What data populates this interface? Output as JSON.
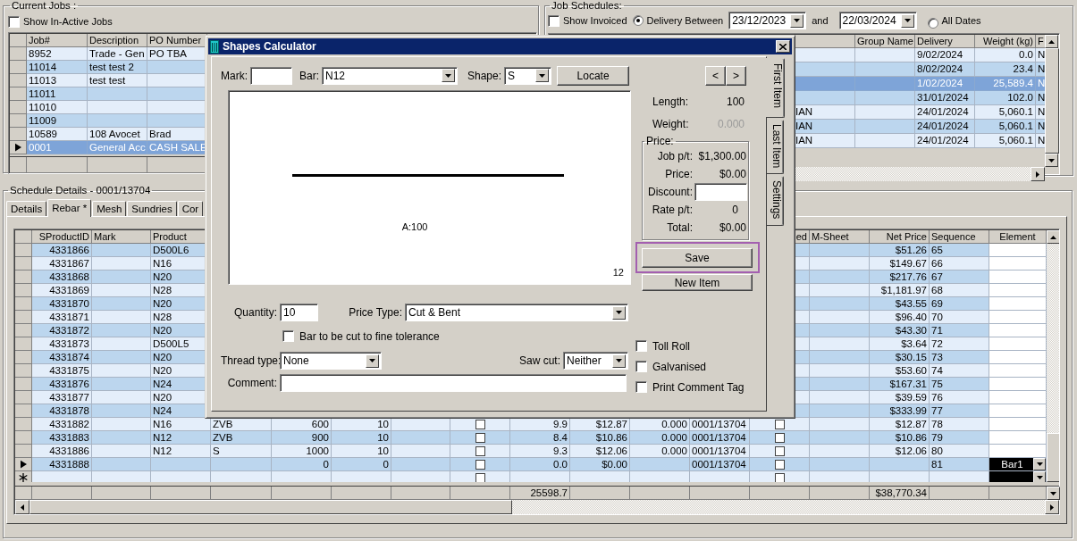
{
  "current_jobs": {
    "title": "Current Jobs :",
    "show_inactive": {
      "label": "Show In-Active Jobs",
      "checked": false
    },
    "headers": {
      "job": "Job#",
      "description": "Description",
      "po_number": "PO Number"
    },
    "rows": [
      {
        "job": "8952",
        "description": "Trade - Gen",
        "po_number": "PO TBA",
        "selected": false
      },
      {
        "job": "11014",
        "description": "test test 2",
        "selected": false
      },
      {
        "job": "11013",
        "description": "test test",
        "selected": false
      },
      {
        "job": "11011",
        "selected": false
      },
      {
        "job": "11010",
        "selected": false
      },
      {
        "job": "11009",
        "selected": false
      },
      {
        "job": "10589",
        "description": "108 Avocet",
        "po_number": "Brad",
        "selected": false
      },
      {
        "job": "0001",
        "description": "General Acc",
        "po_number": "CASH SALE",
        "selected": true
      }
    ]
  },
  "job_schedules": {
    "title": "Job Schedules:",
    "show_invoiced": {
      "label": "Show Invoiced",
      "checked": false
    },
    "delivery_between": {
      "label": "Delivery Between",
      "selected": true
    },
    "from_date": "23/12/2023",
    "and_label": "and",
    "to_date": "22/03/2024",
    "all_dates": {
      "label": "All Dates",
      "selected": false
    },
    "headers": {
      "group_name": "Group Name",
      "delivery": "Delivery",
      "weight": "Weight (kg)",
      "column_f": "F"
    },
    "rows": [
      {
        "delivery": "9/02/2024",
        "weight": "0.0",
        "column_f": "N",
        "selected": false
      },
      {
        "delivery": "8/02/2024",
        "weight": "23.4",
        "column_f": "N",
        "selected": false
      },
      {
        "delivery": "1/02/2024",
        "weight": "25,589.4",
        "column_f": "N",
        "selected": true
      },
      {
        "delivery": "31/01/2024",
        "weight": "102.0",
        "column_f": "N",
        "selected": false
      },
      {
        "column_1": "IAN",
        "delivery": "24/01/2024",
        "weight": "5,060.1",
        "column_f": "N",
        "selected": false
      },
      {
        "column_1": "IAN",
        "delivery": "24/01/2024",
        "weight": "5,060.1",
        "column_f": "N",
        "selected": false
      },
      {
        "column_1": "IAN",
        "delivery": "24/01/2024",
        "weight": "5,060.1",
        "column_f": "N",
        "selected": false
      }
    ]
  },
  "schedule_details": {
    "title": "Schedule Details - 0001/13704",
    "tabs": [
      {
        "label": "Details",
        "selected": false
      },
      {
        "label": "Rebar *",
        "selected": true
      },
      {
        "label": "Mesh",
        "selected": false
      },
      {
        "label": "Sundries",
        "selected": false
      },
      {
        "label": "Cor",
        "selected": false
      }
    ],
    "headers": {
      "sproduct_id": "SProductID",
      "mark": "Mark",
      "product": "Product",
      "column_13": "ed",
      "m_sheet": "M-Sheet",
      "net_price": "Net Price",
      "sequence": "Sequence",
      "element": "Element"
    },
    "rows": [
      {
        "kind": "data",
        "sproduct_id": "4331866",
        "product": "D500L6",
        "net_price": "$51.26",
        "sequence": "65"
      },
      {
        "kind": "data",
        "sproduct_id": "4331867",
        "product": "N16",
        "net_price": "$149.67",
        "sequence": "66"
      },
      {
        "kind": "data",
        "sproduct_id": "4331868",
        "product": "N20",
        "net_price": "$217.76",
        "sequence": "67"
      },
      {
        "kind": "data",
        "sproduct_id": "4331869",
        "product": "N28",
        "net_price": "$1,181.97",
        "sequence": "68"
      },
      {
        "kind": "data",
        "sproduct_id": "4331870",
        "product": "N20",
        "net_price": "$43.55",
        "sequence": "69"
      },
      {
        "kind": "data",
        "sproduct_id": "4331871",
        "product": "N28",
        "net_price": "$96.40",
        "sequence": "70"
      },
      {
        "kind": "data",
        "sproduct_id": "4331872",
        "product": "N20",
        "net_price": "$43.30",
        "sequence": "71"
      },
      {
        "kind": "data",
        "sproduct_id": "4331873",
        "product": "D500L5",
        "net_price": "$3.64",
        "sequence": "72"
      },
      {
        "kind": "data",
        "sproduct_id": "4331874",
        "product": "N20",
        "net_price": "$30.15",
        "sequence": "73"
      },
      {
        "kind": "data",
        "sproduct_id": "4331875",
        "product": "N20",
        "net_price": "$53.60",
        "sequence": "74"
      },
      {
        "kind": "data",
        "sproduct_id": "4331876",
        "product": "N24",
        "net_price": "$167.31",
        "sequence": "75"
      },
      {
        "kind": "data",
        "sproduct_id": "4331877",
        "product": "N20",
        "net_price": "$39.59",
        "sequence": "76"
      },
      {
        "kind": "data",
        "sproduct_id": "4331878",
        "product": "N24",
        "net_price": "$333.99",
        "sequence": "77"
      },
      {
        "kind": "data",
        "sproduct_id": "4331882",
        "product": "N16",
        "column_4": "ZVB",
        "column_5": "600",
        "column_6": "10",
        "column_8_checked": false,
        "column_9": "9.9",
        "column_10": "$12.87",
        "column_11": "0.000",
        "column_12": "0001/13704",
        "column_13_checked": false,
        "net_price": "$12.87",
        "sequence": "78"
      },
      {
        "kind": "data",
        "sproduct_id": "4331883",
        "product": "N12",
        "column_4": "ZVB",
        "column_5": "900",
        "column_6": "10",
        "column_8_checked": false,
        "column_9": "8.4",
        "column_10": "$10.86",
        "column_11": "0.000",
        "column_12": "0001/13704",
        "column_13_checked": false,
        "net_price": "$10.86",
        "sequence": "79"
      },
      {
        "kind": "data",
        "sproduct_id": "4331886",
        "product": "N12",
        "column_4": "S",
        "column_5": "1000",
        "column_6": "10",
        "column_8_checked": false,
        "column_9": "9.3",
        "column_10": "$12.06",
        "column_11": "0.000",
        "column_12": "0001/13704",
        "column_13_checked": false,
        "net_price": "$12.06",
        "sequence": "80"
      },
      {
        "kind": "current",
        "sproduct_id": "4331888",
        "column_5": "0",
        "column_6": "0",
        "column_8_checked": false,
        "column_9": "0.0",
        "column_10": "$0.00",
        "column_12": "0001/13704",
        "column_13_checked": false,
        "sequence": "81",
        "element": "Bar1"
      },
      {
        "kind": "new",
        "column_8_checked": false,
        "column_13_checked": false
      }
    ],
    "totals": {
      "column_9": "25598.7",
      "net_price": "$38,770.34"
    }
  },
  "shapes_calculator": {
    "title": "Shapes Calculator",
    "mark": {
      "label": "Mark:"
    },
    "bar": {
      "label": "Bar:",
      "value": "N12"
    },
    "shape": {
      "label": "Shape:",
      "value": "S"
    },
    "locate_button": "Locate",
    "prev_button": "<",
    "next_button": ">",
    "preview": {
      "dimension": "A:100",
      "bar_size": "12"
    },
    "length": {
      "label": "Length:",
      "value": "100"
    },
    "weight": {
      "label": "Weight:",
      "value": "0.000",
      "disabled": true
    },
    "price_group": {
      "title": "Price:",
      "job_pt": {
        "label": "Job p/t:",
        "value": "$1,300.00"
      },
      "price": {
        "label": "Price:",
        "value": "$0.00"
      },
      "discount": {
        "label": "Discount:"
      },
      "rate_pt": {
        "label": "Rate p/t:",
        "value": "0"
      },
      "total": {
        "label": "Total:",
        "value": "$0.00"
      }
    },
    "save_button": {
      "label": "Save",
      "highlighted": true
    },
    "new_item_button": "New Item",
    "quantity": {
      "label": "Quantity:",
      "value": "10"
    },
    "price_type": {
      "label": "Price Type:",
      "value": "Cut & Bent"
    },
    "fine_tolerance": {
      "label": "Bar to be cut to fine tolerance",
      "checked": false
    },
    "thread_type": {
      "label": "Thread type:",
      "value": "None"
    },
    "saw_cut": {
      "label": "Saw cut:",
      "value": "Neither"
    },
    "comment": {
      "label": "Comment:"
    },
    "options": [
      {
        "label": "Toll Roll",
        "checked": false
      },
      {
        "label": "Galvanised",
        "checked": false
      },
      {
        "label": "Print Comment Tag",
        "checked": false
      }
    ],
    "side_tabs": [
      {
        "label": "First Item",
        "selected": true
      },
      {
        "label": "Last Item",
        "selected": false
      },
      {
        "label": "Settings",
        "selected": false
      }
    ]
  }
}
